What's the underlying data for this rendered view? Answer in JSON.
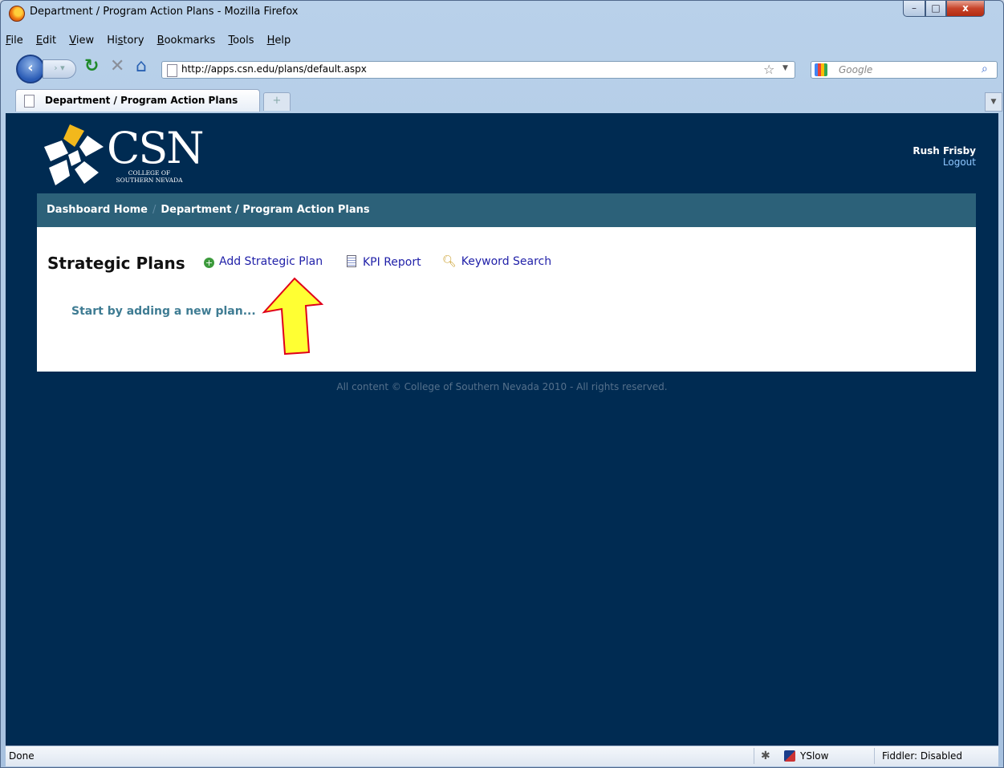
{
  "window": {
    "title": "Department / Program Action Plans - Mozilla Firefox"
  },
  "menu": {
    "items": [
      {
        "label": "File",
        "mnemonic": "F",
        "rest": "ile"
      },
      {
        "label": "Edit",
        "mnemonic": "E",
        "rest": "dit"
      },
      {
        "label": "View",
        "mnemonic": "V",
        "rest": "iew"
      },
      {
        "label": "History",
        "pre": "Hi",
        "mnemonic": "s",
        "rest": "tory"
      },
      {
        "label": "Bookmarks",
        "mnemonic": "B",
        "rest": "ookmarks"
      },
      {
        "label": "Tools",
        "mnemonic": "T",
        "rest": "ools"
      },
      {
        "label": "Help",
        "mnemonic": "H",
        "rest": "elp"
      }
    ]
  },
  "nav": {
    "url": "http://apps.csn.edu/plans/default.aspx",
    "search_placeholder": "Google"
  },
  "tab": {
    "label": "Department / Program Action Plans"
  },
  "site": {
    "logo_text": "CSN",
    "logo_sub_1": "COLLEGE OF",
    "logo_sub_2": "SOUTHERN NEVADA",
    "user_name": "Rush Frisby",
    "logout": "Logout",
    "breadcrumb": [
      "Dashboard Home",
      "Department / Program Action Plans"
    ],
    "breadcrumb_sep": "/",
    "page_title": "Strategic Plans",
    "actions": {
      "add": "Add Strategic Plan",
      "kpi": "KPI Report",
      "search": "Keyword Search"
    },
    "empty_message": "Start by adding a new plan...",
    "footer": "All content © College of Southern Nevada 2010 - All rights reserved."
  },
  "status": {
    "text": "Done",
    "yslow": "YSlow",
    "fiddler": "Fiddler: Disabled"
  },
  "colors": {
    "page_bg": "#002b52",
    "breadcrumb_bg": "#2c6179",
    "link": "#1f1fa8",
    "empty_text": "#3f7c93",
    "arrow_fill": "#ffff33",
    "arrow_stroke": "#e0001a",
    "logo_accent": "#f2b81c"
  }
}
